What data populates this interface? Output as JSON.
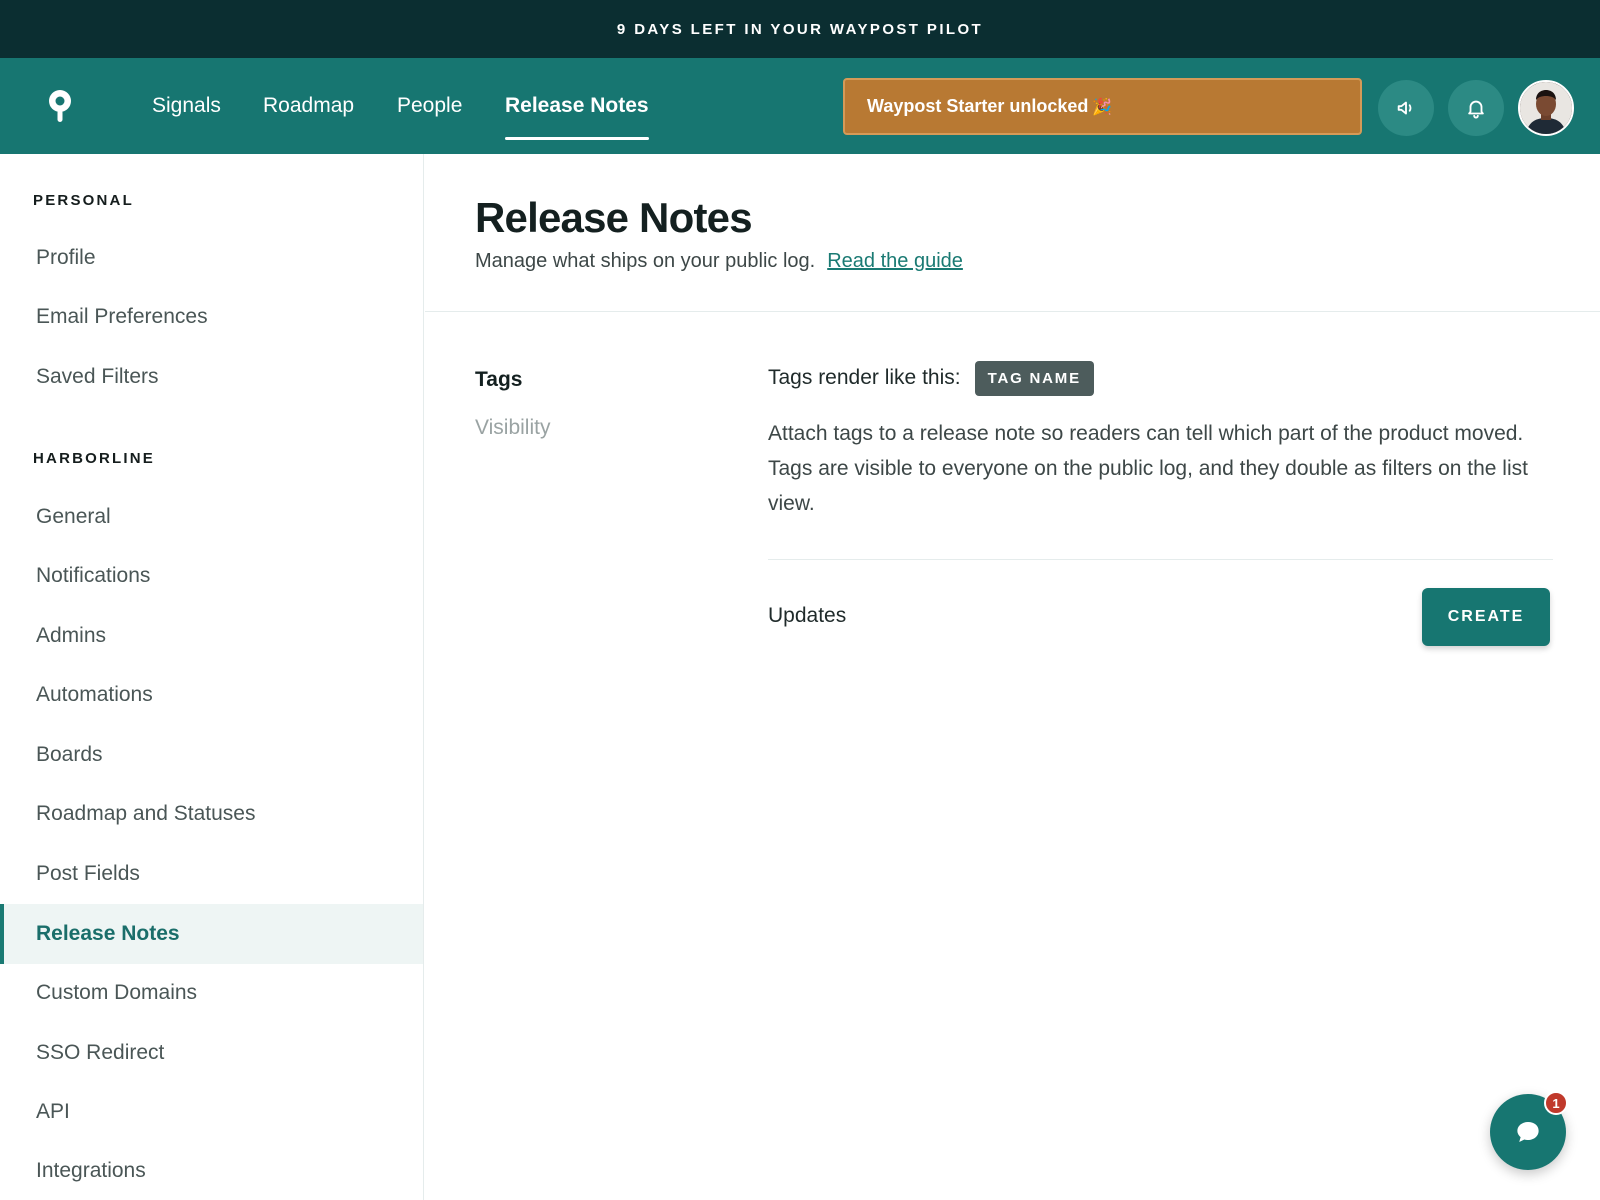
{
  "trial_banner": {
    "text": "9 DAYS LEFT IN YOUR WAYPOST PILOT"
  },
  "topbar": {
    "logo_icon": "map-pin-icon",
    "nav": [
      {
        "label": "Signals",
        "active": false
      },
      {
        "label": "Roadmap",
        "active": false
      },
      {
        "label": "People",
        "active": false
      },
      {
        "label": "Release Notes",
        "active": true
      }
    ],
    "promo": {
      "label": "Waypost Starter unlocked",
      "icon": "party-popper-icon",
      "glyph": "🎉"
    },
    "actions": [
      {
        "name": "announcements",
        "icon": "megaphone-icon"
      },
      {
        "name": "notifications",
        "icon": "bell-icon"
      }
    ],
    "avatar_icon": "user-avatar"
  },
  "sidebar": {
    "groups": [
      {
        "heading": "PERSONAL",
        "items": [
          "Profile",
          "Email Preferences",
          "Saved Filters"
        ]
      },
      {
        "heading": "HARBORLINE",
        "items": [
          "General",
          "Notifications",
          "Admins",
          "Automations",
          "Boards",
          "Roadmap and Statuses",
          "Post Fields",
          "Release Notes",
          "Custom Domains",
          "SSO Redirect",
          "API",
          "Integrations"
        ]
      }
    ],
    "active_item": "Release Notes"
  },
  "main": {
    "title": "Release Notes",
    "subtitle": "Manage what ships on your public log.",
    "guide_link": "Read the guide",
    "section_nav": [
      {
        "label": "Tags",
        "active": true
      },
      {
        "label": "Visibility",
        "active": false
      }
    ],
    "tags": {
      "preview_label": "Tags render like this:",
      "chip_label": "TAG NAME",
      "description": "Attach tags to a release note so readers can tell which part of the product moved. Tags are visible to everyone on the public log, and they double as filters on the list view.",
      "updates_label": "Updates",
      "create_label": "CREATE"
    }
  },
  "chat": {
    "icon": "chat-bubble-icon",
    "badge": "1"
  },
  "colors": {
    "brand": "#177671",
    "banner": "#0b2e31",
    "promo": "#b87933",
    "active_text": "#1a6e6a",
    "badge": "#c0392b"
  }
}
